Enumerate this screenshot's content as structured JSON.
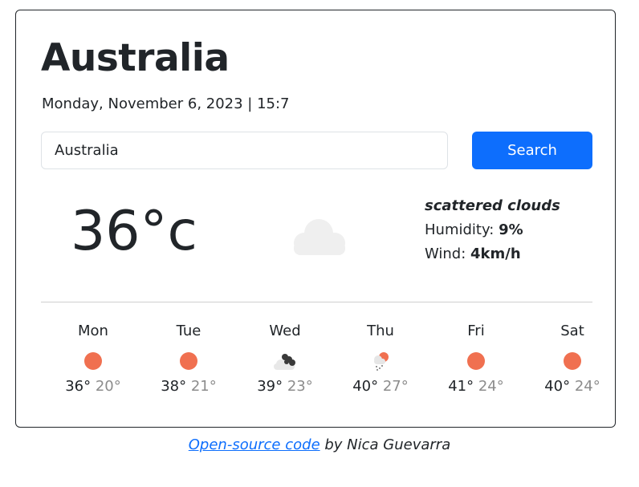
{
  "location": {
    "city": "Australia",
    "datetime": "Monday, November 6, 2023 | 15:7"
  },
  "search": {
    "value": "Australia",
    "button_label": "Search"
  },
  "current": {
    "temperature": "36°c",
    "condition_icon": "cloud-icon",
    "description": "scattered clouds",
    "humidity_label": "Humidity: ",
    "humidity_value": "9%",
    "wind_label": "Wind: ",
    "wind_value": "4km/h"
  },
  "forecast": [
    {
      "day": "Mon",
      "icon": "sun-icon",
      "high": "36°",
      "low": "20°"
    },
    {
      "day": "Tue",
      "icon": "sun-icon",
      "high": "38°",
      "low": "21°"
    },
    {
      "day": "Wed",
      "icon": "dark-clouds-icon",
      "high": "39°",
      "low": "23°"
    },
    {
      "day": "Thu",
      "icon": "sun-rain-icon",
      "high": "40°",
      "low": "27°"
    },
    {
      "day": "Fri",
      "icon": "sun-icon",
      "high": "41°",
      "low": "24°"
    },
    {
      "day": "Sat",
      "icon": "sun-icon",
      "high": "40°",
      "low": "24°"
    }
  ],
  "footer": {
    "link_text": "Open-source code",
    "suffix": " by Nica Guevarra"
  },
  "colors": {
    "accent": "#0d6efd",
    "sun": "#f07050",
    "low_temp": "#8c8c8c"
  }
}
